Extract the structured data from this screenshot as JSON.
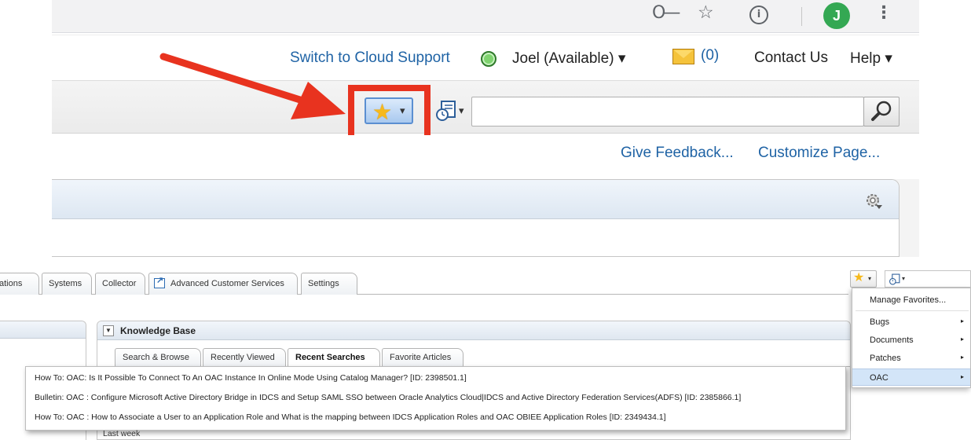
{
  "browser": {
    "key_icon": "O—",
    "star_icon": "☆",
    "info_icon": "i",
    "avatar_letter": "J",
    "more_icon": "⋮"
  },
  "global_header": {
    "switch_link": "Switch to Cloud Support",
    "user_status": "Joel (Available) ▾",
    "messages_count": "(0)",
    "contact": "Contact Us",
    "help": "Help ▾"
  },
  "toolbar": {
    "favorites_star": "★",
    "caret": "▾",
    "search_value": ""
  },
  "page_links": {
    "feedback": "Give Feedback...",
    "customize": "Customize Page..."
  },
  "tabs": [
    {
      "label": "ations"
    },
    {
      "label": "Systems"
    },
    {
      "label": "Collector"
    },
    {
      "label": "Advanced Customer Services"
    },
    {
      "label": "Settings"
    }
  ],
  "knowledge_base": {
    "title": "Knowledge Base",
    "collapse_icon": "▼",
    "tabs": [
      {
        "label": "Search & Browse"
      },
      {
        "label": "Recently Viewed"
      },
      {
        "label": "Recent Searches"
      },
      {
        "label": "Favorite Articles"
      }
    ],
    "active_tab": "Recent Searches",
    "last_week_label": "Last week"
  },
  "results": [
    {
      "text": "How To: OAC: Is It Possible To Connect To An OAC Instance In Online Mode Using Catalog Manager? [ID: 2398501.1]"
    },
    {
      "text": "Bulletin: OAC : Configure Microsoft Active Directory Bridge in IDCS and Setup SAML SSO between Oracle Analytics Cloud|IDCS and Active Directory Federation Services(ADFS) [ID: 2385866.1]"
    },
    {
      "text": "How To: OAC : How to Associate a User to an Application Role and What is the mapping between IDCS Application Roles and OAC OBIEE Application Roles [ID: 2349434.1]"
    }
  ],
  "favorites_menu": {
    "items": [
      {
        "label": "Manage Favorites...",
        "has_submenu": false
      },
      {
        "label": "Bugs",
        "has_submenu": true
      },
      {
        "label": "Documents",
        "has_submenu": true
      },
      {
        "label": "Patches",
        "has_submenu": true
      },
      {
        "label": "OAC",
        "has_submenu": true
      }
    ],
    "selected": "OAC",
    "submenu_arrow": "▸"
  },
  "colors": {
    "link": "#1f63a5",
    "highlight": "#e8331f",
    "selected_menu": "#d3e5f8",
    "star": "#f6b91c"
  }
}
